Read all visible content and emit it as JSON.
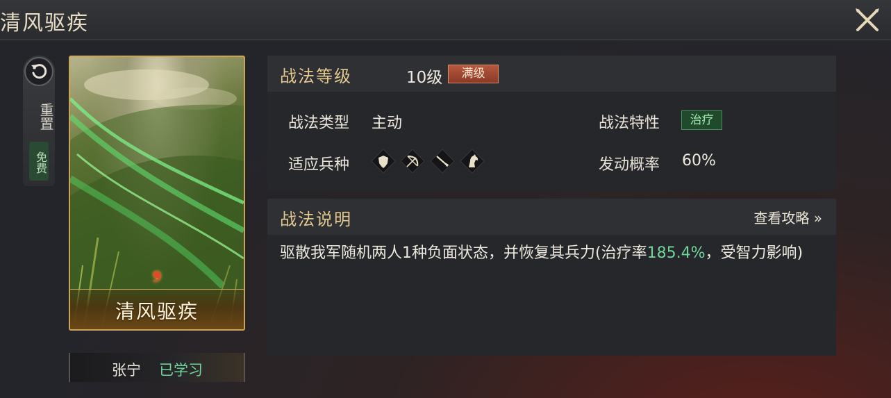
{
  "title": "清风驱疾",
  "reset": {
    "label": "重置",
    "free_label": "免费"
  },
  "card": {
    "name": "清风驱疾",
    "learner": "张宁",
    "status": "已学习"
  },
  "info": {
    "level_title": "战法等级",
    "level_value": "10级",
    "max_badge": "满级",
    "type_label": "战法类型",
    "type_value": "主动",
    "trait_label": "战法特性",
    "trait_value": "治疗",
    "troops_label": "适应兵种",
    "troops": [
      "shield-troop-icon",
      "bow-troop-icon",
      "spear-troop-icon",
      "cavalry-troop-icon"
    ],
    "rate_label": "发动概率",
    "rate_value": "60%"
  },
  "description": {
    "title": "战法说明",
    "guide_link": "查看攻略 »",
    "text_before": "驱散我军随机两人1种负面状态，并恢复其兵力(治疗率",
    "text_highlight": "185.4%",
    "text_after": "，受智力影响)"
  },
  "colors": {
    "accent_gold": "#e3c88f",
    "highlight_green": "#6fd59a",
    "max_badge": "#a4492f",
    "trait_badge": "#1f4a2c"
  }
}
